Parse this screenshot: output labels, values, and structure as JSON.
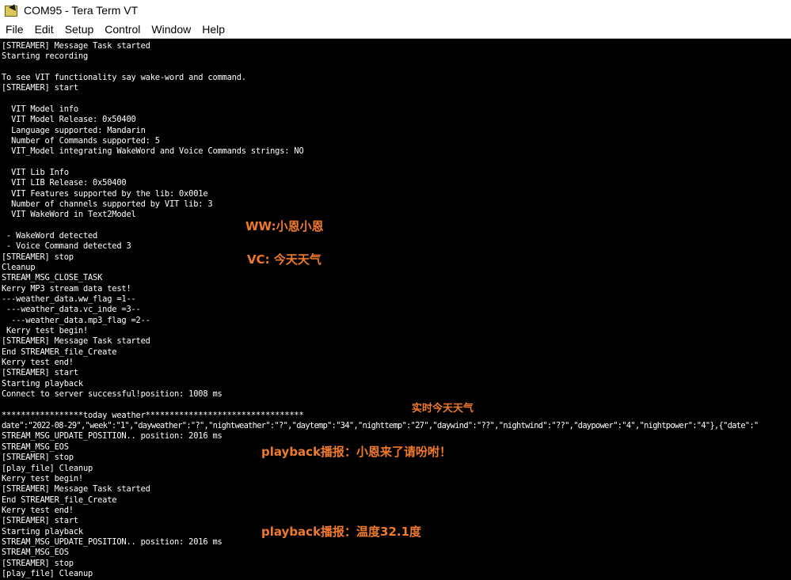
{
  "window": {
    "title": "COM95 - Tera Term VT",
    "app_icon": "teraterm-icon"
  },
  "menu": {
    "items": [
      {
        "label": "File"
      },
      {
        "label": "Edit"
      },
      {
        "label": "Setup"
      },
      {
        "label": "Control"
      },
      {
        "label": "Window"
      },
      {
        "label": "Help"
      }
    ]
  },
  "terminal": {
    "lines": [
      "[STREAMER] Message Task started",
      "Starting recording",
      "",
      "To see VIT functionality say wake-word and command.",
      "[STREAMER] start",
      "",
      "  VIT Model info",
      "  VIT Model Release: 0x50400",
      "  Language supported: Mandarin",
      "  Number of Commands supported: 5",
      "  VIT_Model integrating WakeWord and Voice Commands strings: NO",
      "",
      "  VIT Lib Info",
      "  VIT LIB Release: 0x50400",
      "  VIT Features supported by the lib: 0x001e",
      "  Number of channels supported by VIT lib: 3",
      "  VIT WakeWord in Text2Model",
      "",
      " - WakeWord detected",
      " - Voice Command detected 3",
      "[STREAMER] stop",
      "Cleanup",
      "STREAM_MSG_CLOSE_TASK",
      "Kerry MP3 stream data test!",
      "---weather_data.ww_flag =1--",
      " ---weather_data.vc_inde =3--",
      "  ---weather_data.mp3_flag =2--",
      " Kerry test begin!",
      "[STREAMER] Message Task started",
      "End STREAMER_file_Create",
      "Kerry test end!",
      "[STREAMER] start",
      "Starting playback",
      "Connect to server successful!position: 1008 ms",
      "",
      "*****************today weather*********************************",
      "date\":\"2022-08-29\",\"week\":\"1\",\"dayweather\":\"?\",\"nightweather\":\"?\",\"daytemp\":\"34\",\"nighttemp\":\"27\",\"daywind\":\"??\",\"nightwind\":\"??\",\"daypower\":\"4\",\"nightpower\":\"4\"},{\"date\":\"",
      "STREAM_MSG_UPDATE_POSITION.. position: 2016 ms",
      "STREAM_MSG_EOS",
      "[STREAMER] stop",
      "[play_file] Cleanup",
      "Kerry test begin!",
      "[STREAMER] Message Task started",
      "End STREAMER_file_Create",
      "Kerry test end!",
      "[STREAMER] start",
      "Starting playback",
      "STREAM_MSG_UPDATE_POSITION.. position: 2016 ms",
      "STREAM_MSG_EOS",
      "[STREAMER] stop",
      "[play_file] Cleanup"
    ]
  },
  "annotations": {
    "ww": "WW:小恩小恩",
    "vc": "VC: 今天天气",
    "realtime": "实时今天天气",
    "playback1": "playback播报：小恩来了请吩咐！",
    "playback2": "playback播报：温度32.1度",
    "color": "#f07a2a"
  }
}
